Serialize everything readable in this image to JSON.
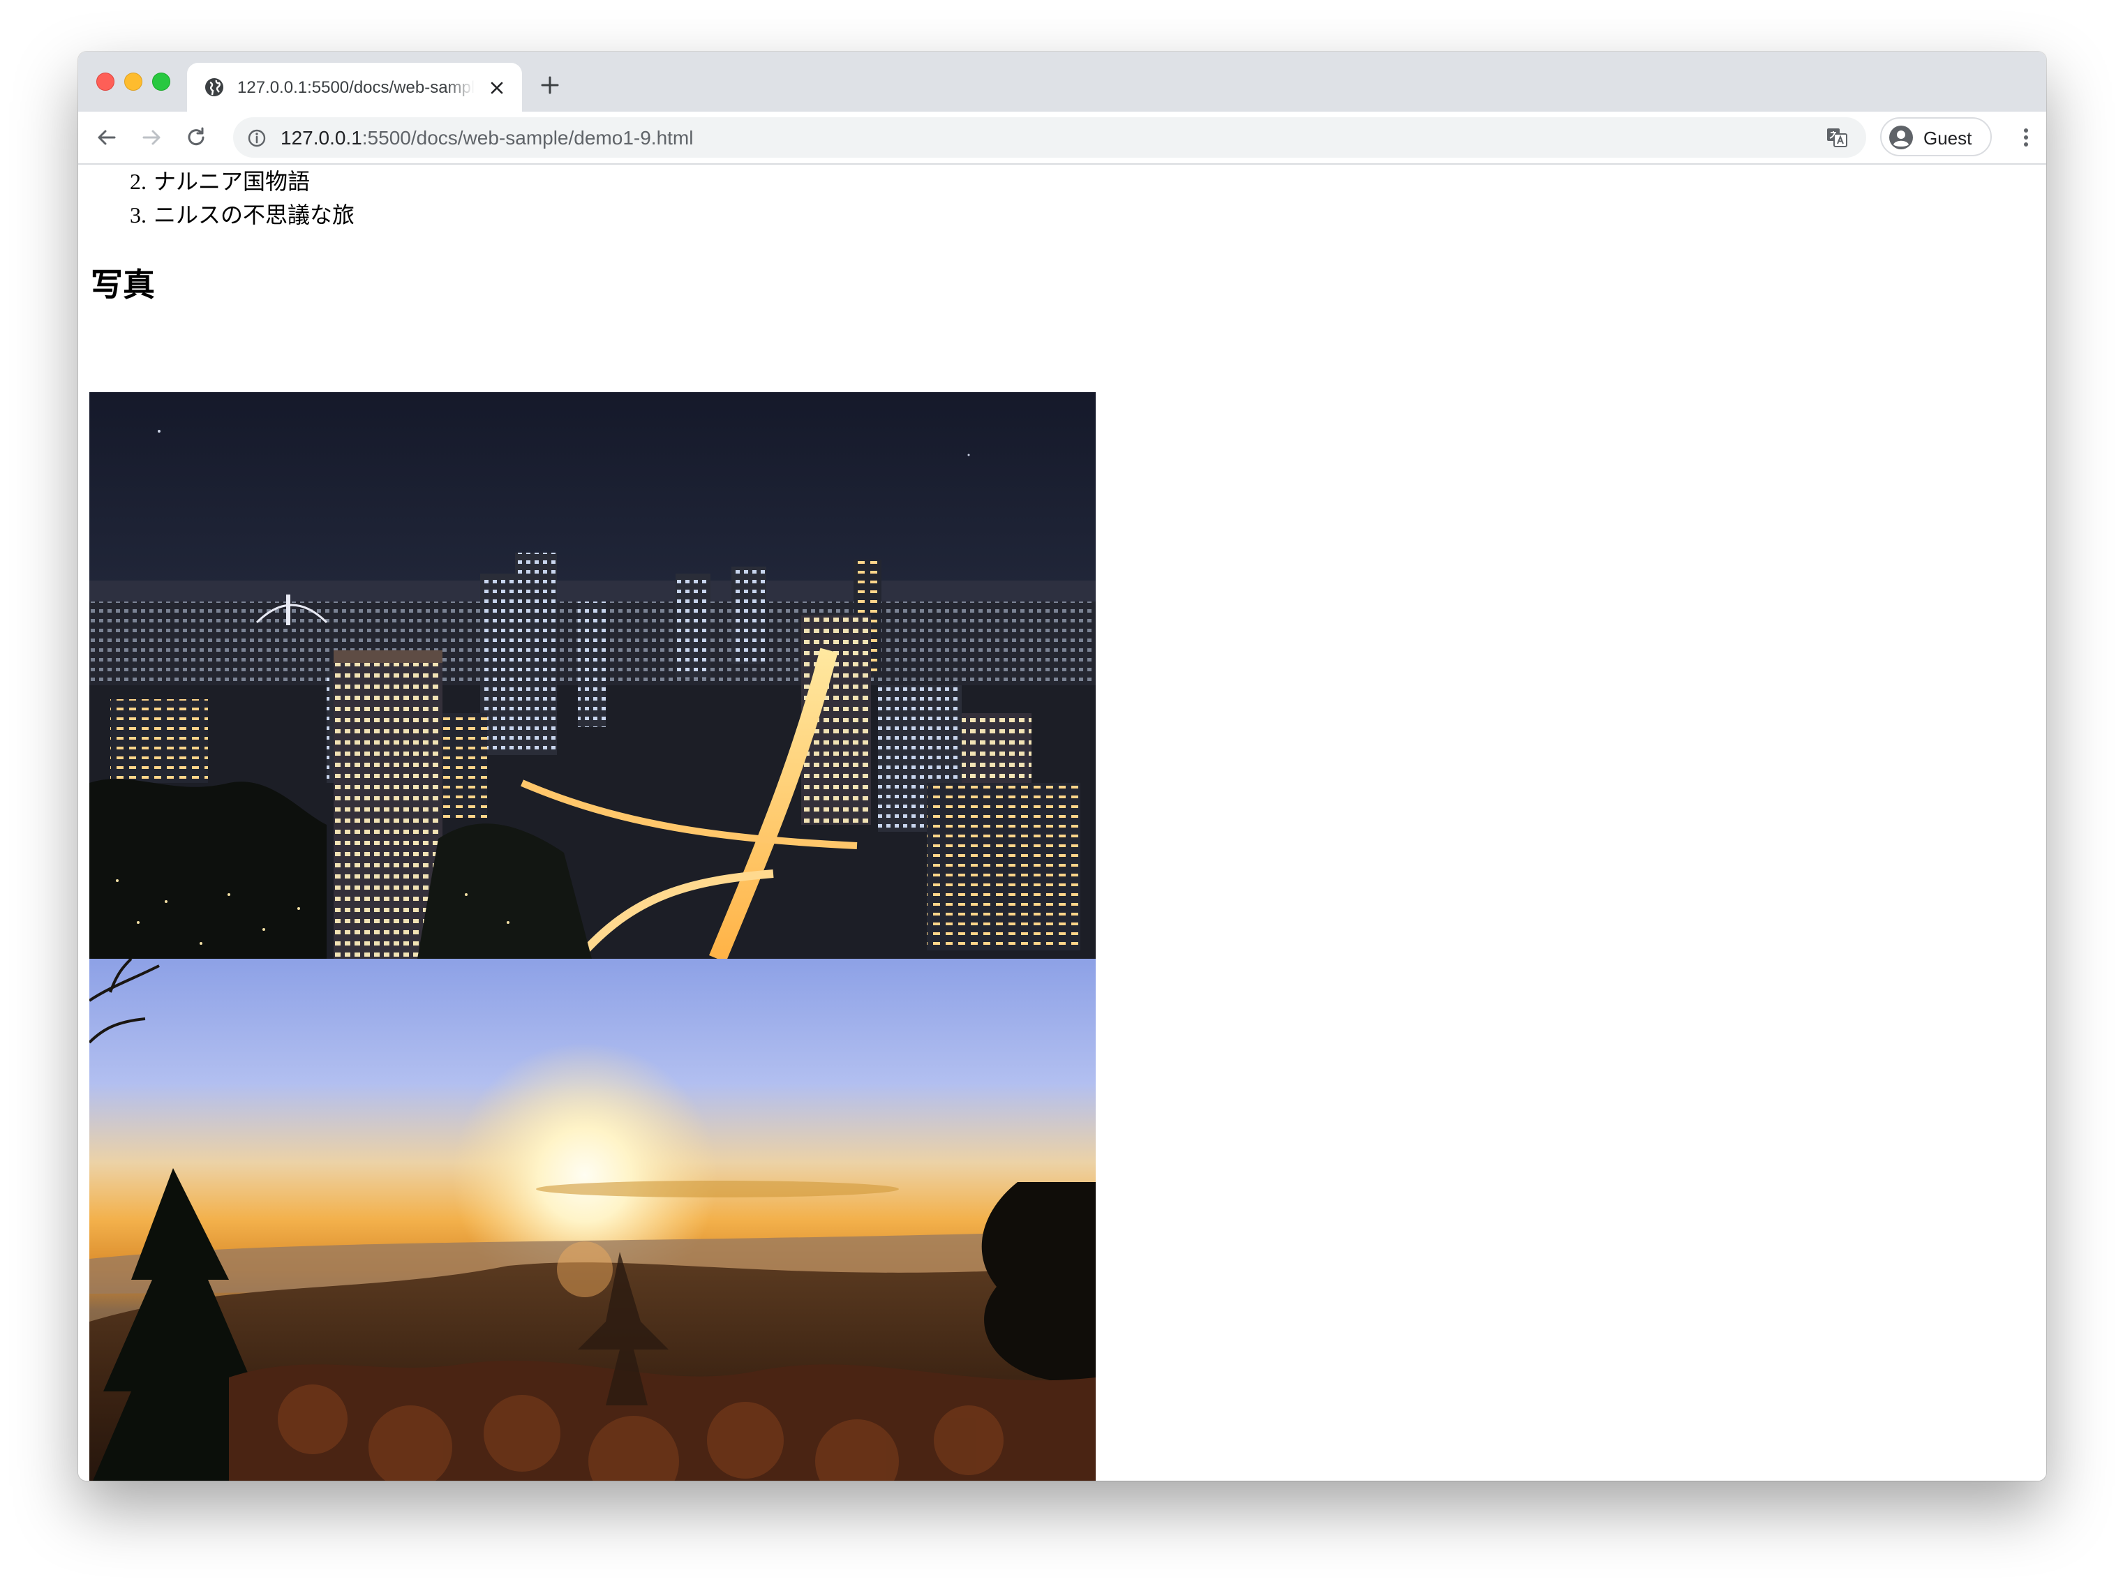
{
  "browser": {
    "tab": {
      "title": "127.0.0.1:5500/docs/web-sample/demo1-9.html",
      "favicon": "globe-icon",
      "close_icon": "close-icon"
    },
    "new_tab_icon": "plus-icon",
    "toolbar": {
      "back_icon": "arrow-left-icon",
      "forward_icon": "arrow-right-icon",
      "reload_icon": "reload-icon",
      "site_info_icon": "info-icon",
      "url_host": "127.0.0.1",
      "url_rest": ":5500/docs/web-sample/demo1-9.html",
      "translate_icon": "translate-icon",
      "profile_label": "Guest",
      "menu_icon": "kebab-menu-icon"
    }
  },
  "page": {
    "list": [
      {
        "number": "2.",
        "text": "ナルニア国物語"
      },
      {
        "number": "3.",
        "text": "ニルスの不思議な旅"
      }
    ],
    "section_heading": "写真",
    "photos": [
      {
        "name": "night-city-photo"
      },
      {
        "name": "sunrise-forest-photo"
      }
    ]
  },
  "colors": {
    "tabstrip_bg": "#dee1e6",
    "omnibox_bg": "#f1f3f4",
    "traffic_red": "#fe5f57",
    "traffic_yellow": "#febc2e",
    "traffic_green": "#28c840"
  }
}
